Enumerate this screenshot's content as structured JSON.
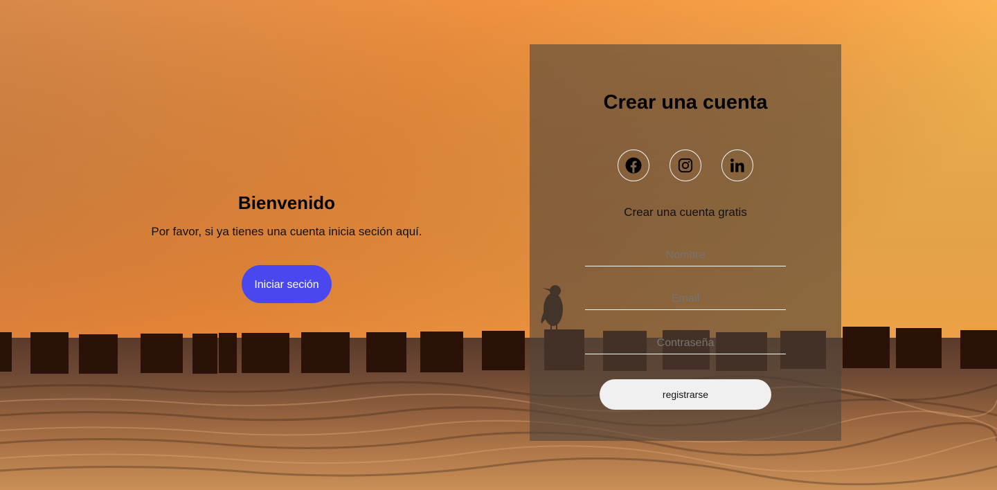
{
  "welcome": {
    "title": "Bienvenido",
    "message": "Por favor, si ya tienes una cuenta inicia seción aquí.",
    "login_button": "Iniciar seción"
  },
  "register": {
    "title": "Crear una cuenta",
    "socials": [
      {
        "icon": "facebook-icon"
      },
      {
        "icon": "instagram-icon"
      },
      {
        "icon": "linkedin-icon"
      }
    ],
    "subtitle": "Crear una cuenta gratis",
    "name_placeholder": "Nombre",
    "email_placeholder": "Email",
    "password_placeholder": "Contraseña",
    "submit_button": "registrarse"
  },
  "colors": {
    "login_button": "#4a47ef",
    "register_button": "#f0f0f0",
    "panel_overlay": "#52463a"
  }
}
